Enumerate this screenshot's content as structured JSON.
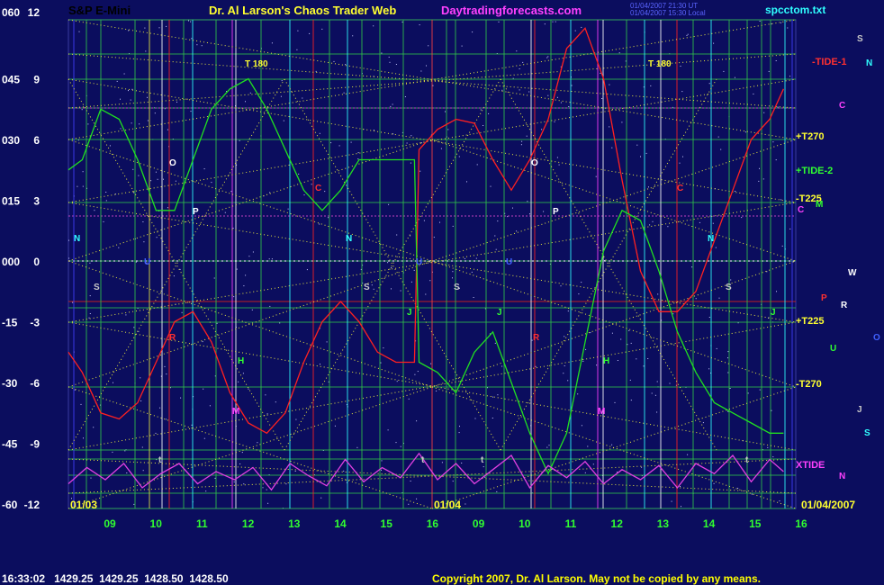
{
  "header": {
    "symbol": "S&P E-Mini",
    "title": "Dr. Al Larson's Chaos Trader Web",
    "site": "Daytradingforecasts.com",
    "ut_line1": "01/04/2007 21:30 UT",
    "ut_line2": "01/04/2007 15:30 Local",
    "file": "spcctom.txt"
  },
  "colors": {
    "background": "#0b0d5e",
    "price_red": "#ff2020",
    "green_line": "#20e020",
    "xtide_magenta": "#e040e0",
    "grid_yellow": "#e8e840",
    "header_red": "#ff2020",
    "header_yellow": "#ffff30",
    "header_magenta": "#ff40ff",
    "file_cyan": "#30ffff"
  },
  "y_axis_left": [
    "060",
    "045",
    "030",
    "015",
    "000",
    "-15",
    "-30",
    "-45",
    "-60"
  ],
  "y_axis_right": [
    "12",
    "9",
    "6",
    "3",
    "0",
    "-3",
    "-6",
    "-9",
    "-12"
  ],
  "x_axis_labels": [
    "09",
    "10",
    "11",
    "12",
    "13",
    "14",
    "15",
    "16",
    "09",
    "10",
    "11",
    "12",
    "13",
    "14",
    "15",
    "16"
  ],
  "date_labels": [
    "01/03",
    "01/04",
    "01/04/2007"
  ],
  "right_labels": [
    {
      "text": "-TIDE-1",
      "color": "#ff3030"
    },
    {
      "text": "+T270",
      "color": "#ffff30"
    },
    {
      "text": "+TIDE-2",
      "color": "#30ff30"
    },
    {
      "text": "-T225",
      "color": "#ffff30"
    },
    {
      "text": "+T225",
      "color": "#ffff30"
    },
    {
      "text": "-T270",
      "color": "#ffff30"
    },
    {
      "text": "XTIDE",
      "color": "#ff40ff"
    }
  ],
  "side_letters": [
    "S",
    "N",
    "C",
    "M",
    "W",
    "P",
    "R",
    "O",
    "U",
    "J",
    "S",
    "N",
    "C"
  ],
  "chart_letters": [
    "T 180",
    "T 180",
    "O",
    "O",
    "C",
    "C",
    "P",
    "P",
    "N",
    "N",
    "N",
    "U",
    "U",
    "U",
    "S",
    "S",
    "S",
    "S",
    "R",
    "R",
    "H",
    "H",
    "M",
    "M",
    "J",
    "J",
    "J",
    "t",
    "t",
    "t",
    "t"
  ],
  "status": {
    "time": "16:33:02",
    "prices": [
      "1429.25",
      "1429.25",
      "1428.50",
      "1428.50"
    ]
  },
  "copyright": "Copyright 2007, Dr. Al Larson. May not be copied by any means.",
  "chart_data": [
    {
      "type": "line",
      "name": "S&P E-Mini price",
      "x_hours": [
        "09",
        "10",
        "11",
        "12",
        "13",
        "14",
        "15",
        "16",
        "09",
        "10",
        "11",
        "12",
        "13",
        "14",
        "15",
        "16"
      ],
      "ylim": [
        -12,
        12
      ],
      "x": [
        8.5,
        8.8,
        9.2,
        9.6,
        10.0,
        10.4,
        10.8,
        11.2,
        11.6,
        12.0,
        12.4,
        12.8,
        13.2,
        13.6,
        14.0,
        14.4,
        14.8,
        15.2,
        15.6,
        16.0,
        16.1,
        16.5,
        16.9,
        17.3,
        17.7,
        18.1,
        18.5,
        18.9,
        19.3,
        19.7,
        20.1,
        20.5,
        20.9,
        21.3,
        21.7,
        22.1,
        22.5,
        22.9,
        23.3,
        23.7,
        24.0
      ],
      "y": [
        -4.5,
        -5.5,
        -7.5,
        -7.8,
        -7.0,
        -5.0,
        -3.0,
        -2.5,
        -4.0,
        -6.5,
        -8.0,
        -8.5,
        -7.5,
        -5.0,
        -3.0,
        -2.0,
        -3.0,
        -4.5,
        -5.0,
        -5.0,
        5.5,
        6.5,
        7.0,
        6.8,
        5.0,
        3.5,
        5.0,
        7.0,
        10.5,
        11.5,
        9.0,
        4.0,
        -0.5,
        -2.5,
        -2.5,
        -1.5,
        1.0,
        3.5,
        6.0,
        7.0,
        8.5
      ]
    },
    {
      "type": "line",
      "name": "Green composite line",
      "ylim": [
        -12,
        12
      ],
      "x": [
        8.5,
        8.8,
        9.2,
        9.6,
        10.0,
        10.4,
        10.8,
        11.2,
        11.6,
        12.0,
        12.4,
        12.8,
        13.2,
        13.6,
        14.0,
        14.4,
        14.8,
        15.2,
        15.6,
        16.0,
        16.1,
        16.5,
        16.9,
        17.3,
        17.7,
        18.1,
        18.5,
        18.9,
        19.3,
        19.7,
        20.1,
        20.5,
        20.9,
        21.3,
        21.7,
        22.1,
        22.5,
        22.9,
        23.3,
        23.7,
        24.0
      ],
      "y": [
        4.5,
        5.0,
        7.5,
        7.0,
        5.0,
        2.5,
        2.5,
        5.0,
        7.5,
        8.5,
        9.0,
        7.5,
        5.5,
        3.5,
        2.5,
        3.5,
        5.0,
        5.0,
        5.0,
        5.0,
        -5.0,
        -5.5,
        -6.5,
        -4.5,
        -3.5,
        -6.0,
        -8.5,
        -10.5,
        -8.5,
        -4.0,
        0.5,
        2.5,
        2.0,
        -0.5,
        -3.5,
        -5.5,
        -7.0,
        -7.5,
        -8.0,
        -8.5,
        -8.5
      ]
    },
    {
      "type": "line",
      "name": "XTIDE",
      "ylim": [
        -12,
        12
      ],
      "x": [
        8.5,
        8.9,
        9.3,
        9.7,
        10.1,
        10.5,
        10.9,
        11.3,
        11.7,
        12.1,
        12.5,
        12.9,
        13.3,
        13.7,
        14.1,
        14.5,
        14.9,
        15.3,
        15.7,
        16.1,
        16.5,
        16.9,
        17.3,
        17.7,
        18.1,
        18.5,
        18.9,
        19.3,
        19.7,
        20.1,
        20.5,
        20.9,
        21.3,
        21.7,
        22.1,
        22.5,
        22.9,
        23.3,
        23.7,
        24.0
      ],
      "y": [
        -11.0,
        -10.2,
        -10.8,
        -10.0,
        -11.2,
        -10.5,
        -10.0,
        -11.0,
        -10.4,
        -10.8,
        -10.2,
        -11.3,
        -10.0,
        -10.6,
        -11.1,
        -9.8,
        -10.9,
        -10.2,
        -10.7,
        -9.5,
        -10.8,
        -10.0,
        -11.0,
        -10.3,
        -9.6,
        -11.2,
        -10.1,
        -10.7,
        -9.9,
        -11.0,
        -10.3,
        -10.8,
        -10.1,
        -11.2,
        -10.0,
        -10.5,
        -9.6,
        -10.9,
        -9.8,
        -10.4
      ]
    }
  ]
}
